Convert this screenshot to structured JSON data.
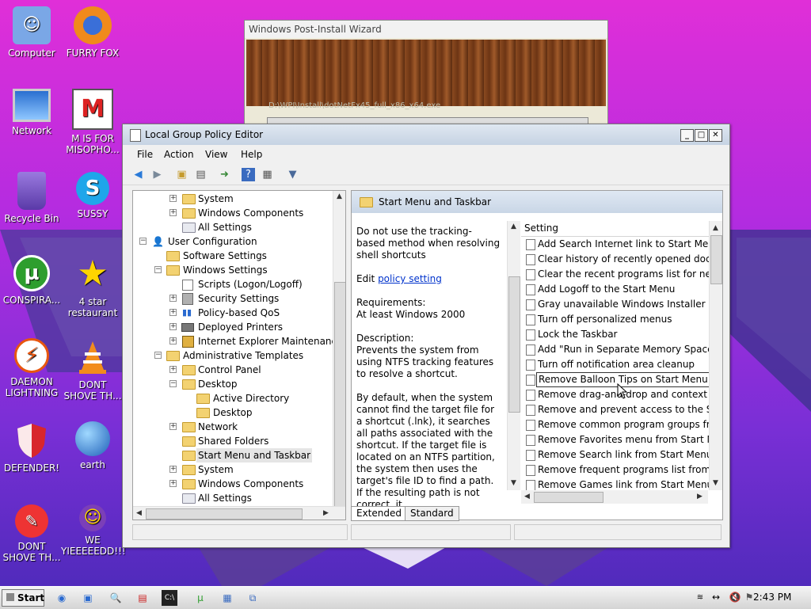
{
  "desktop": {
    "icons": [
      {
        "label": "Computer"
      },
      {
        "label": "FURRY FOX"
      },
      {
        "label": "Network"
      },
      {
        "label": "M IS FOR MISOPHO..."
      },
      {
        "label": "Recycle Bin"
      },
      {
        "label": "SUSSY"
      },
      {
        "label": "CONSPIRA..."
      },
      {
        "label": "4 star restaurant"
      },
      {
        "label": "DAEMON LIGHTNING"
      },
      {
        "label": "DONT SHOVE TH..."
      },
      {
        "label": "DEFENDER!"
      },
      {
        "label": "earth"
      },
      {
        "label": "DONT SHOVE TH..."
      },
      {
        "label": "WE YIEEEEEDD!!!"
      }
    ]
  },
  "wizard": {
    "title": "Windows Post-Install Wizard",
    "path": "D:\\WPI\\Install\\dotNetFx45_full_x86_x64.exe"
  },
  "gpe": {
    "title": "Local Group Policy Editor",
    "menu": [
      "File",
      "Action",
      "View",
      "Help"
    ],
    "tree": [
      {
        "label": "System"
      },
      {
        "label": "Windows Components"
      },
      {
        "label": "All Settings"
      },
      {
        "label": "User Configuration"
      },
      {
        "label": "Software Settings"
      },
      {
        "label": "Windows Settings"
      },
      {
        "label": "Scripts (Logon/Logoff)"
      },
      {
        "label": "Security Settings"
      },
      {
        "label": "Policy-based QoS"
      },
      {
        "label": "Deployed Printers"
      },
      {
        "label": "Internet Explorer Maintenance"
      },
      {
        "label": "Administrative Templates"
      },
      {
        "label": "Control Panel"
      },
      {
        "label": "Desktop"
      },
      {
        "label": "Active Directory"
      },
      {
        "label": "Desktop"
      },
      {
        "label": "Network"
      },
      {
        "label": "Shared Folders"
      },
      {
        "label": "Start Menu and Taskbar"
      },
      {
        "label": "System"
      },
      {
        "label": "Windows Components"
      },
      {
        "label": "All Settings"
      }
    ],
    "right": {
      "header": "Start Menu and Taskbar",
      "desc_title": "Do not use the tracking-based method when resolving shell shortcuts",
      "edit_prefix": "Edit ",
      "edit_link": "policy setting",
      "req_label": "Requirements:",
      "req_value": "At least Windows 2000",
      "desc_label": "Description:",
      "desc_body": "Prevents the system from using NTFS tracking features to resolve a shortcut.",
      "desc_body2": "By default, when the system cannot find the target file for a shortcut (.lnk), it searches all paths associated with the shortcut. If the target file is located on an NTFS partition, the system then uses the target's file ID to find a path. If the resulting path is not correct, it",
      "list_header": "Setting",
      "settings": [
        "Add Search Internet link to Start Menu",
        "Clear history of recently opened documents",
        "Clear the recent programs list for new",
        "Add Logoff to the Start Menu",
        "Gray unavailable Windows Installer pro",
        "Turn off personalized menus",
        "Lock the Taskbar",
        "Add \"Run in Separate Memory Space\"",
        "Turn off notification area cleanup",
        "Remove Balloon Tips on Start Menu items",
        "Remove drag-and-drop and context m",
        "Remove and prevent access to the Shu",
        "Remove common program groups fro",
        "Remove Favorites menu from Start M",
        "Remove Search link from Start Menu",
        "Remove frequent programs list from t",
        "Remove Games link from Start Menu"
      ]
    },
    "tabs": [
      "Extended",
      "Standard"
    ]
  },
  "taskbar": {
    "start": "Start",
    "clock": "2:43 PM"
  }
}
